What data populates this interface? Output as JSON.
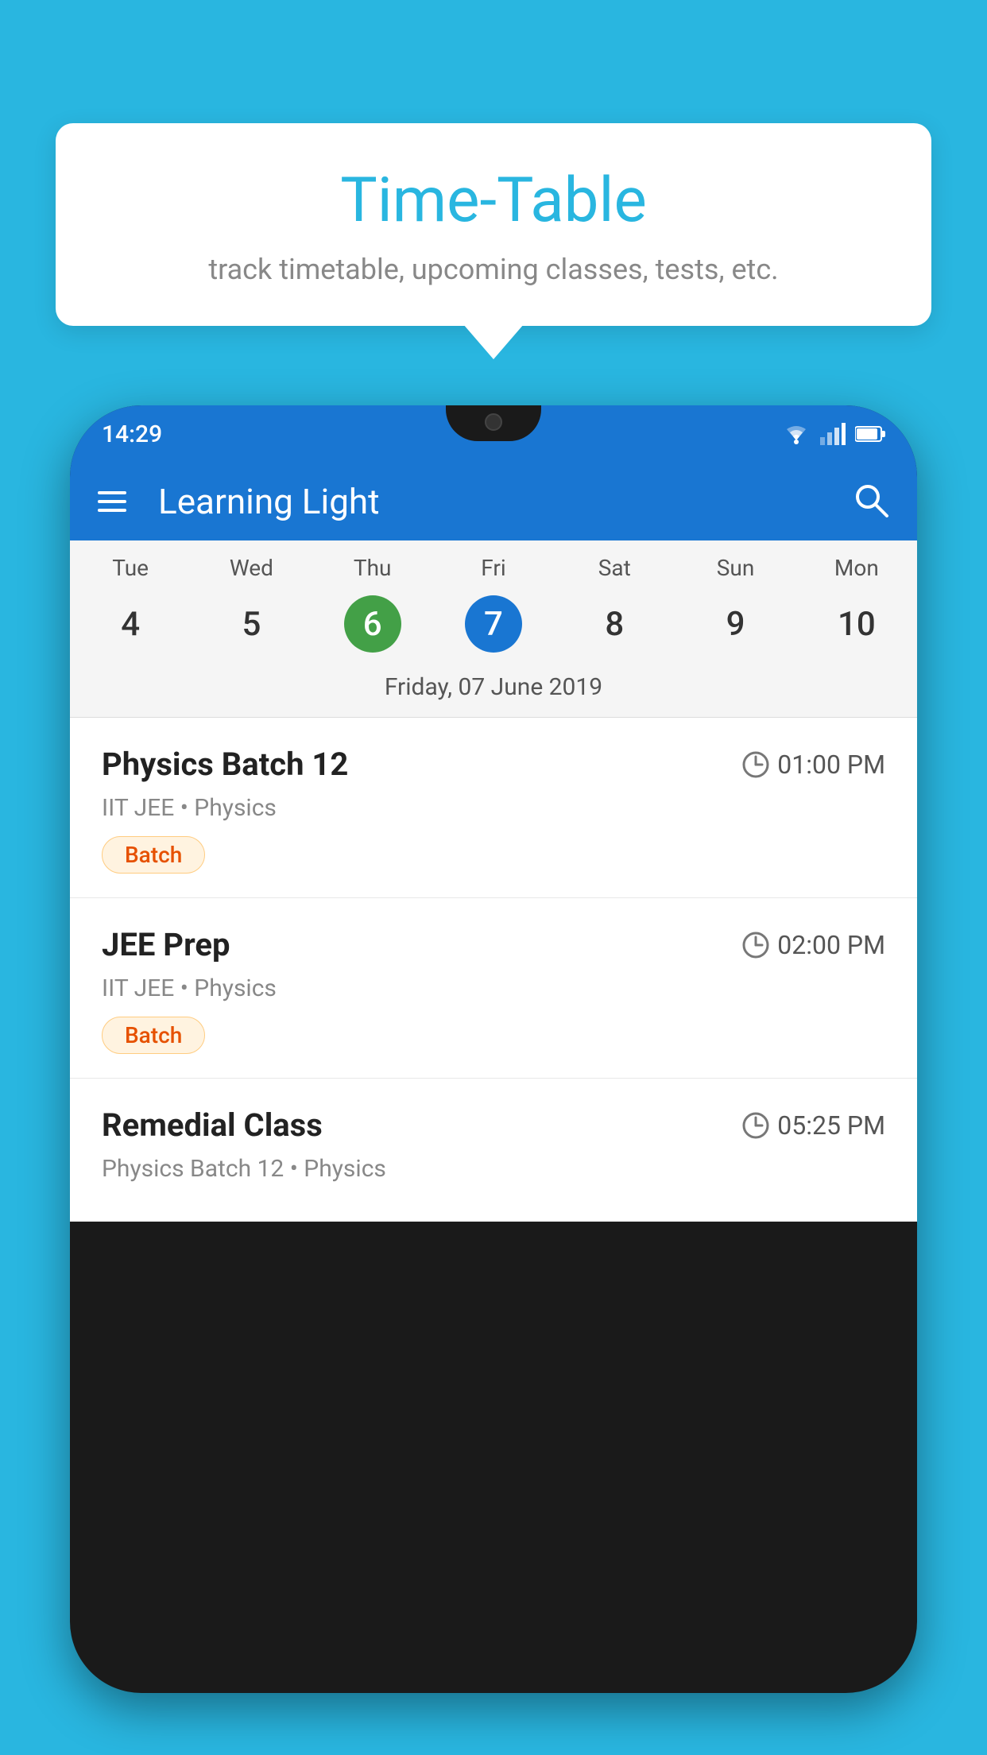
{
  "page": {
    "background_color": "#29b6e0"
  },
  "tooltip": {
    "title": "Time-Table",
    "subtitle": "track timetable, upcoming classes, tests, etc."
  },
  "status_bar": {
    "time": "14:29"
  },
  "app_bar": {
    "title": "Learning Light",
    "menu_icon": "hamburger-icon",
    "search_icon": "search-icon"
  },
  "calendar": {
    "days": [
      {
        "label": "Tue",
        "num": "4"
      },
      {
        "label": "Wed",
        "num": "5"
      },
      {
        "label": "Thu",
        "num": "6",
        "state": "today"
      },
      {
        "label": "Fri",
        "num": "7",
        "state": "selected"
      },
      {
        "label": "Sat",
        "num": "8"
      },
      {
        "label": "Sun",
        "num": "9"
      },
      {
        "label": "Mon",
        "num": "10"
      }
    ],
    "selected_date_label": "Friday, 07 June 2019"
  },
  "schedule": {
    "items": [
      {
        "title": "Physics Batch 12",
        "time": "01:00 PM",
        "subtitle": "IIT JEE • Physics",
        "badge": "Batch"
      },
      {
        "title": "JEE Prep",
        "time": "02:00 PM",
        "subtitle": "IIT JEE • Physics",
        "badge": "Batch"
      },
      {
        "title": "Remedial Class",
        "time": "05:25 PM",
        "subtitle": "Physics Batch 12 • Physics",
        "badge": ""
      }
    ]
  }
}
